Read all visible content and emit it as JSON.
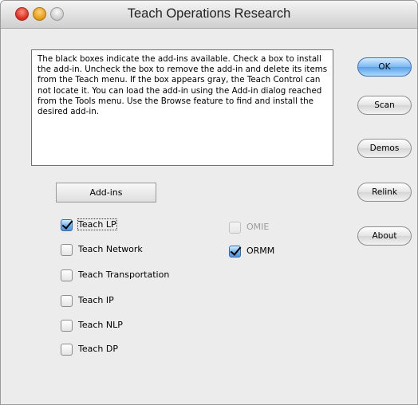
{
  "window": {
    "title": "Teach Operations Research"
  },
  "description": "The black boxes indicate the add-ins available. Check a box to install the add-in.  Uncheck the box to remove the add-in and delete its items from the Teach menu.  If the box appears gray, the Teach Control can not locate it. You can load the add-in using the Add-in dialog reached from the Tools menu. Use the Browse feature to find and install the desired add-in.",
  "buttons": {
    "ok": "OK",
    "scan": "Scan",
    "demos": "Demos",
    "relink": "Relink",
    "about": "About"
  },
  "addins": {
    "header": "Add-ins",
    "left": [
      {
        "label": "Teach LP",
        "checked": true
      },
      {
        "label": "Teach Network",
        "checked": false
      },
      {
        "label": "Teach Transportation",
        "checked": false
      },
      {
        "label": "Teach IP",
        "checked": false
      },
      {
        "label": "Teach NLP",
        "checked": false
      },
      {
        "label": "Teach DP",
        "checked": false
      }
    ],
    "right": [
      {
        "label": "OMIE",
        "checked": false,
        "enabled": false
      },
      {
        "label": "ORMM",
        "checked": true,
        "enabled": true
      }
    ]
  }
}
